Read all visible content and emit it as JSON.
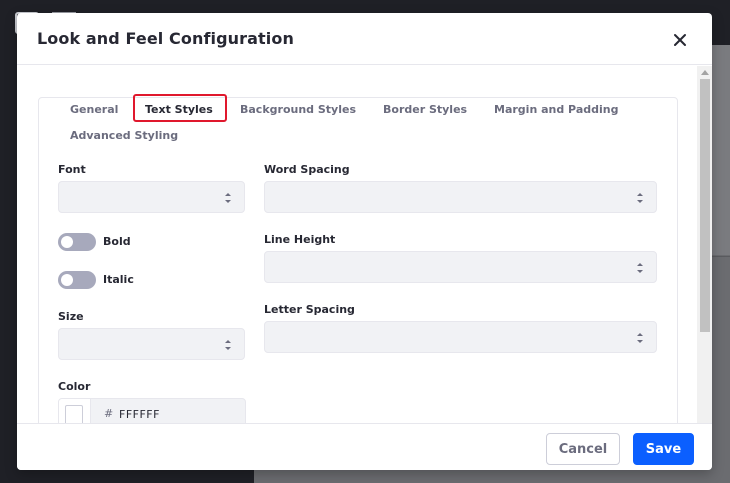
{
  "modal": {
    "title": "Look and Feel Configuration",
    "close_icon": "close-icon"
  },
  "tabs": [
    {
      "label": "General",
      "active": false
    },
    {
      "label": "Text Styles",
      "active": true
    },
    {
      "label": "Background Styles",
      "active": false
    },
    {
      "label": "Border Styles",
      "active": false
    },
    {
      "label": "Margin and Padding",
      "active": false
    },
    {
      "label": "Advanced Styling",
      "active": false
    }
  ],
  "form": {
    "font_label": "Font",
    "font_value": "",
    "bold_label": "Bold",
    "bold_on": false,
    "italic_label": "Italic",
    "italic_on": false,
    "size_label": "Size",
    "size_value": "",
    "color_label": "Color",
    "color_hash": "#",
    "color_value": "FFFFFF",
    "word_spacing_label": "Word Spacing",
    "word_spacing_value": "",
    "line_height_label": "Line Height",
    "line_height_value": "",
    "letter_spacing_label": "Letter Spacing",
    "letter_spacing_value": ""
  },
  "footer": {
    "cancel_label": "Cancel",
    "save_label": "Save"
  },
  "colors": {
    "primary": "#0b5fff",
    "highlight": "#e0182d",
    "toggle_off": "#a7a9bc"
  }
}
